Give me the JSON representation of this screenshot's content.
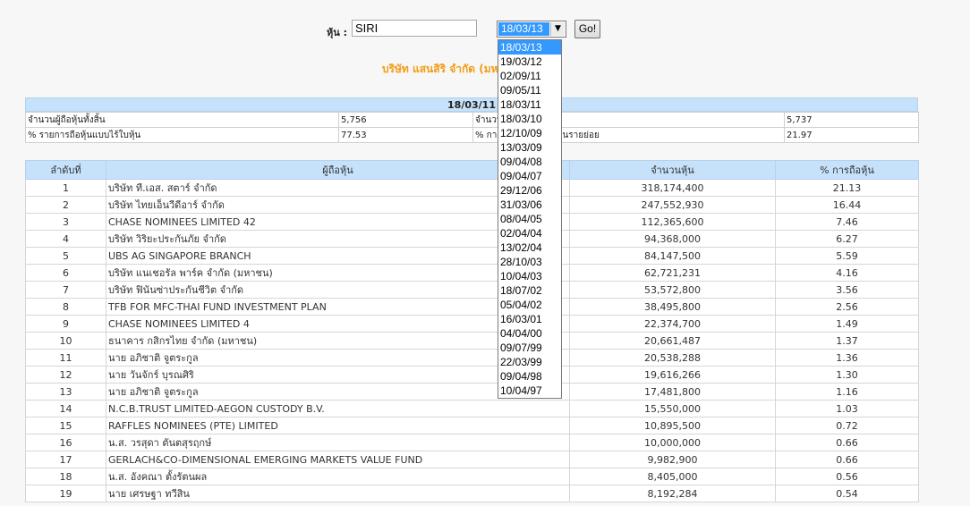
{
  "search": {
    "label": "หุ้น :",
    "value": "SIRI",
    "selected_date": "18/03/13",
    "go_label": "Go!"
  },
  "company_title": "บริษัท แสนสิริ จำกัด (มหาชน) (SIRI)",
  "dropdown": {
    "options": [
      "18/03/13",
      "19/03/12",
      "02/09/11",
      "09/05/11",
      "18/03/11",
      "18/03/10",
      "12/10/09",
      "13/03/09",
      "09/04/08",
      "09/04/07",
      "29/12/06",
      "31/03/06",
      "08/04/05",
      "02/04/04",
      "13/02/04",
      "28/10/03",
      "10/04/03",
      "18/07/02",
      "05/04/02",
      "16/03/01",
      "04/04/00",
      "09/07/99",
      "22/03/99",
      "09/04/98",
      "10/04/97"
    ]
  },
  "summary": {
    "date": "18/03/11",
    "rows": [
      [
        "จำนวนผู้ถือหุ้นทั้งสิ้น",
        "5,756",
        "จำนวนผู้ถือหุ้นรายย่อย",
        "5,737"
      ],
      [
        "% รายการถือหุ้นแบบไร้ใบหุ้น",
        "77.53",
        "% การถือหุ้นของผู้ถือหุ้นรายย่อย",
        "21.97"
      ]
    ]
  },
  "holders": {
    "headers": [
      "ลำดับที่",
      "ผู้ถือหุ้น",
      "จำนวนหุ้น",
      "% การถือหุ้น"
    ],
    "rows": [
      [
        "1",
        "บริษัท ที.เอส. สตาร์ จำกัด",
        "318,174,400",
        "21.13"
      ],
      [
        "2",
        "บริษัท ไทยเอ็นวีดีอาร์ จำกัด",
        "247,552,930",
        "16.44"
      ],
      [
        "3",
        "CHASE NOMINEES LIMITED 42",
        "112,365,600",
        "7.46"
      ],
      [
        "4",
        "บริษัท วิริยะประกันภัย จำกัด",
        "94,368,000",
        "6.27"
      ],
      [
        "5",
        "UBS AG SINGAPORE BRANCH",
        "84,147,500",
        "5.59"
      ],
      [
        "6",
        "บริษัท แนเชอรัล พาร์ค จำกัด (มหาชน)",
        "62,721,231",
        "4.16"
      ],
      [
        "7",
        "บริษัท ฟินันซ่าประกันชีวิต จำกัด",
        "53,572,800",
        "3.56"
      ],
      [
        "8",
        "TFB FOR MFC-THAI FUND INVESTMENT PLAN",
        "38,495,800",
        "2.56"
      ],
      [
        "9",
        "CHASE NOMINEES LIMITED 4",
        "22,374,700",
        "1.49"
      ],
      [
        "10",
        "ธนาคาร กสิกรไทย จำกัด (มหาชน)",
        "20,661,487",
        "1.37"
      ],
      [
        "11",
        "นาย อภิชาติ จูตระกูล",
        "20,538,288",
        "1.36"
      ],
      [
        "12",
        "นาย วันจักร์ บุรณศิริ",
        "19,616,266",
        "1.30"
      ],
      [
        "13",
        "นาย อภิชาติ จูตระกูล",
        "17,481,800",
        "1.16"
      ],
      [
        "14",
        "N.C.B.TRUST LIMITED-AEGON CUSTODY B.V.",
        "15,550,000",
        "1.03"
      ],
      [
        "15",
        "RAFFLES NOMINEES (PTE) LIMITED",
        "10,895,500",
        "0.72"
      ],
      [
        "16",
        "น.ส. วรสุดา ตันตสุรฤกษ์",
        "10,000,000",
        "0.66"
      ],
      [
        "17",
        "GERLACH&CO-DIMENSIONAL EMERGING MARKETS VALUE FUND",
        "9,982,900",
        "0.66"
      ],
      [
        "18",
        "น.ส. อังคณา ตั้งรัตนผล",
        "8,405,000",
        "0.56"
      ],
      [
        "19",
        "นาย เศรษฐา ทวีสิน",
        "8,192,284",
        "0.54"
      ]
    ]
  }
}
